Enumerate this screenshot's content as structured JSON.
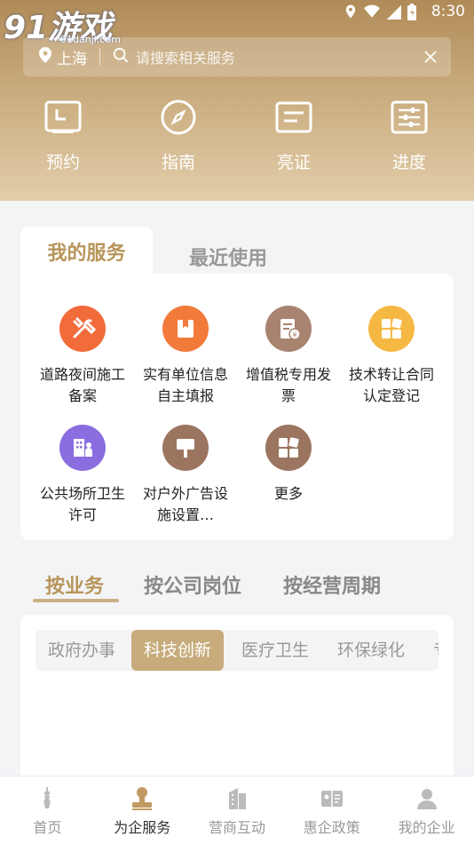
{
  "status": {
    "time": "8:30"
  },
  "watermark": {
    "big": "91游戏",
    "sub": "91danji.com"
  },
  "search": {
    "city": "上海",
    "placeholder": "请搜索相关服务"
  },
  "quick_links": [
    {
      "label": "预约",
      "icon": "calendar-icon"
    },
    {
      "label": "指南",
      "icon": "compass-icon"
    },
    {
      "label": "亮证",
      "icon": "certificate-icon"
    },
    {
      "label": "进度",
      "icon": "progress-icon"
    }
  ],
  "service_tabs": {
    "active": "我的服务",
    "inactive": "最近使用"
  },
  "services": [
    {
      "label": "道路夜间施工备案",
      "icon": "tools-icon",
      "color": "#f26b3a"
    },
    {
      "label": "实有单位信息自主填报",
      "icon": "bookmark-icon",
      "color": "#f27a3a"
    },
    {
      "label": "增值税专用发票",
      "icon": "invoice-icon",
      "color": "#a88470"
    },
    {
      "label": "技术转让合同认定登记",
      "icon": "apps-icon",
      "color": "#f5b843"
    },
    {
      "label": "公共场所卫生许可",
      "icon": "building-icon",
      "color": "#8a6ee0"
    },
    {
      "label": "对户外广告设施设置…",
      "icon": "billboard-icon",
      "color": "#9c7560"
    },
    {
      "label": "更多",
      "icon": "more-icon",
      "color": "#9c7560"
    }
  ],
  "category_tabs": [
    "按业务",
    "按公司岗位",
    "按经营周期"
  ],
  "chips": [
    "政府办事",
    "科技创新",
    "医疗卫生",
    "环保绿化",
    "专"
  ],
  "bottom_nav": [
    {
      "label": "首页",
      "icon": "tower-icon"
    },
    {
      "label": "为企服务",
      "icon": "stamp-icon"
    },
    {
      "label": "营商互动",
      "icon": "building-chat-icon"
    },
    {
      "label": "惠企政策",
      "icon": "policy-icon"
    },
    {
      "label": "我的企业",
      "icon": "user-icon"
    }
  ],
  "colors": {
    "accent": "#b8955a",
    "header_top": "#b08b57",
    "header_bottom": "#e2cdaa"
  }
}
